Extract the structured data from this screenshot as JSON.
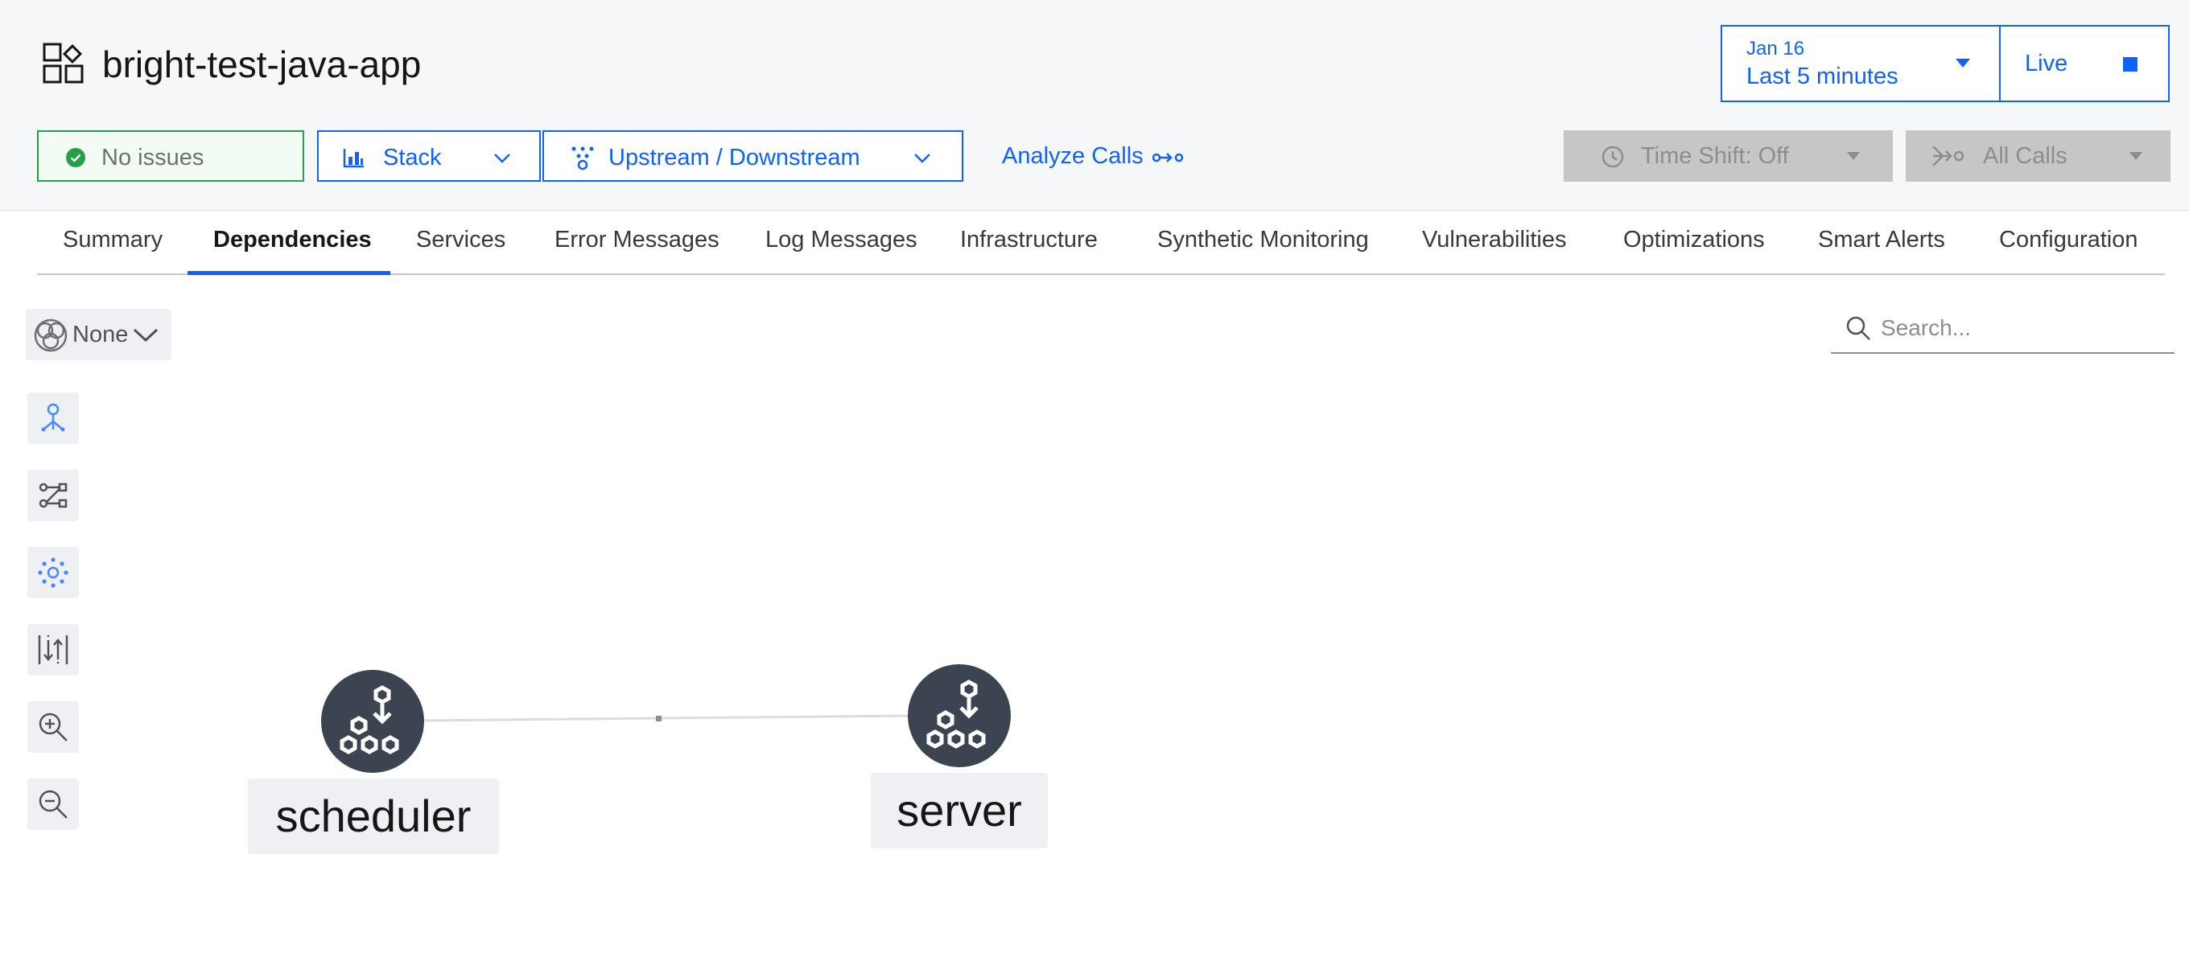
{
  "header": {
    "title": "bright-test-java-app",
    "time_picker": {
      "date": "Jan 16",
      "range": "Last 5 minutes"
    },
    "live": {
      "label": "Live"
    }
  },
  "toolbar": {
    "issues_label": "No issues",
    "stack_label": "Stack",
    "direction_label": "Upstream / Downstream",
    "analyze_label": "Analyze Calls",
    "time_shift_label": "Time Shift: Off",
    "calls_label": "All Calls"
  },
  "tabs": [
    {
      "label": "Summary"
    },
    {
      "label": "Dependencies",
      "active": true
    },
    {
      "label": "Services"
    },
    {
      "label": "Error Messages"
    },
    {
      "label": "Log Messages"
    },
    {
      "label": "Infrastructure"
    },
    {
      "label": "Synthetic Monitoring"
    },
    {
      "label": "Vulnerabilities"
    },
    {
      "label": "Optimizations"
    },
    {
      "label": "Smart Alerts"
    },
    {
      "label": "Configuration"
    }
  ],
  "graph_controls": {
    "group_by_label": "None",
    "tools": [
      "tree-layout-icon",
      "flow-layout-icon",
      "cluster-layout-icon",
      "sort-icon",
      "zoom-in-icon",
      "zoom-out-icon"
    ]
  },
  "search": {
    "placeholder": "Search..."
  },
  "nodes": [
    {
      "label": "scheduler"
    },
    {
      "label": "server"
    }
  ],
  "colors": {
    "accent": "#0f62fe",
    "success": "#24a148",
    "node": "#3d4451",
    "tool_icon": "#4589ff"
  }
}
